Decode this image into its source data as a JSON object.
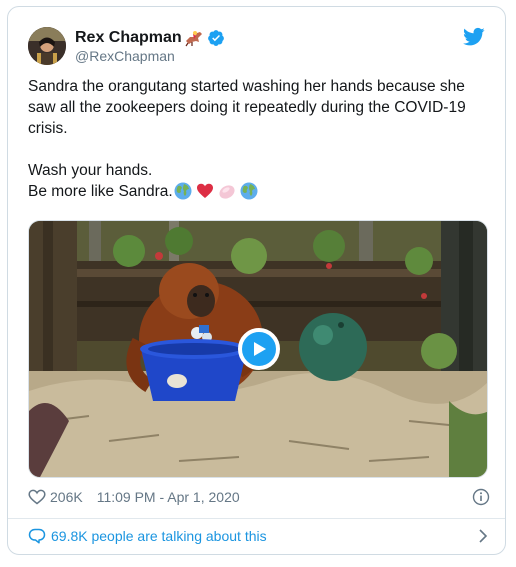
{
  "author": {
    "name": "Rex Chapman",
    "handle": "@RexChapman",
    "name_emoji": "horse-racing-emoji",
    "verified": true
  },
  "tweet": {
    "line1": "Sandra the orangutang started washing her hands because she saw all the zookeepers doing it repeatedly during the COVID-19 crisis.",
    "line2": "Wash your hands.",
    "line3": "Be more like Sandra.",
    "line3_emojis": [
      "globe-emoji",
      "red-heart-emoji",
      "soap-emoji",
      "globe-emoji"
    ]
  },
  "media": {
    "type": "video",
    "play_icon": "play-icon"
  },
  "footer": {
    "likes": "206K",
    "timestamp": "11:09 PM - Apr 1, 2020"
  },
  "conversation": {
    "text": "69.8K people are talking about this"
  },
  "colors": {
    "accent": "#1da1f2",
    "link": "#1b95e0",
    "text": "#14171a",
    "secondary": "#657786",
    "border": "#d0dbe3"
  }
}
